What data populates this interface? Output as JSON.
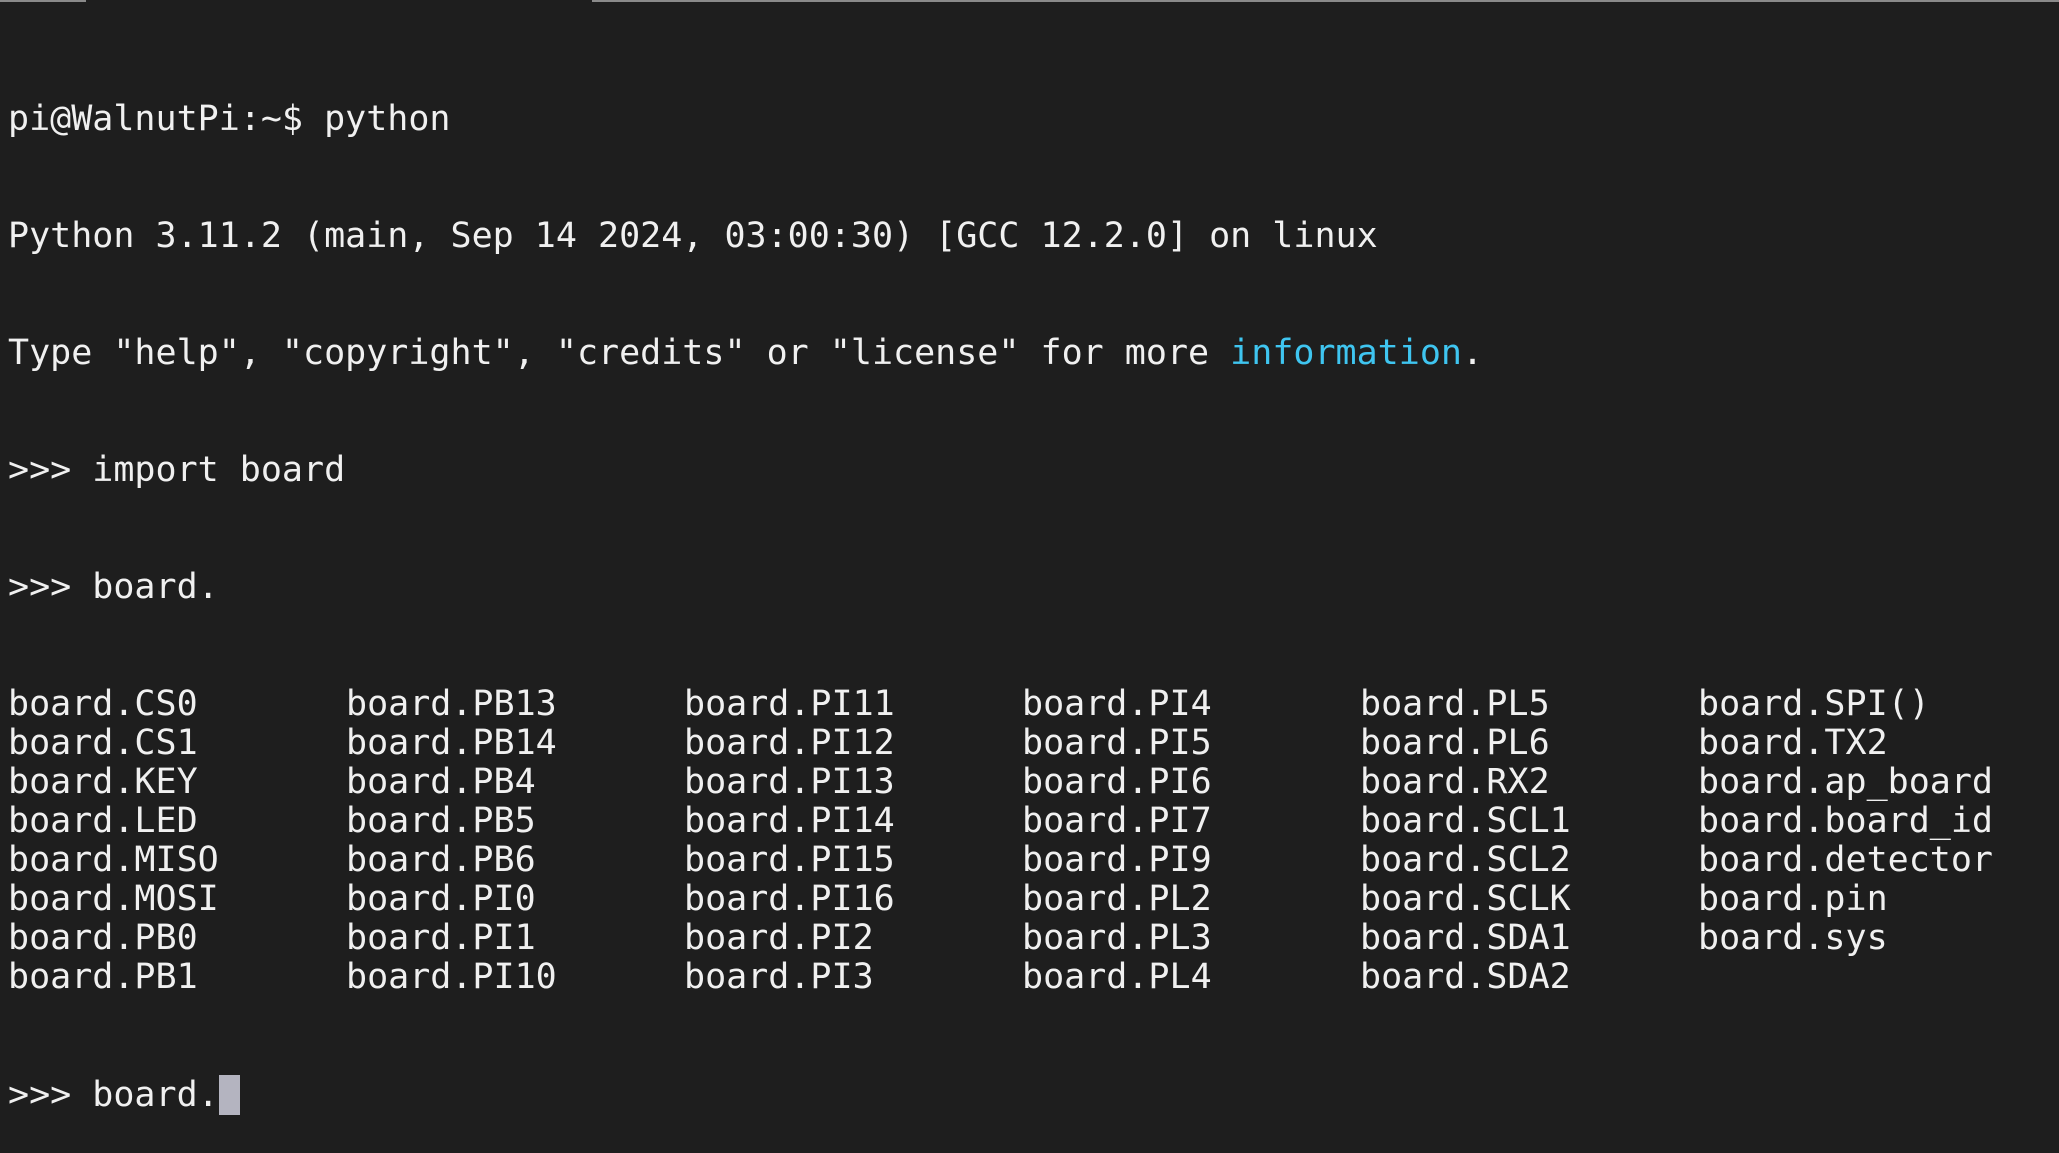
{
  "terminal": {
    "prompt_line": "pi@WalnutPi:~$ python",
    "banner_line": "Python 3.11.2 (main, Sep 14 2024, 03:00:30) [GCC 12.2.0] on linux",
    "hint_prefix": "Type \"help\", \"copyright\", \"credits\" or \"license\" for more ",
    "hint_link": "information",
    "hint_suffix": ".",
    "import_line": ">>> import board",
    "completion_input": ">>> board.",
    "completions": [
      [
        "board.CS0",
        "board.PB13",
        "board.PI11",
        "board.PI4",
        "board.PL5",
        "board.SPI()"
      ],
      [
        "board.CS1",
        "board.PB14",
        "board.PI12",
        "board.PI5",
        "board.PL6",
        "board.TX2"
      ],
      [
        "board.KEY",
        "board.PB4",
        "board.PI13",
        "board.PI6",
        "board.RX2",
        "board.ap_board"
      ],
      [
        "board.LED",
        "board.PB5",
        "board.PI14",
        "board.PI7",
        "board.SCL1",
        "board.board_id"
      ],
      [
        "board.MISO",
        "board.PB6",
        "board.PI15",
        "board.PI9",
        "board.SCL2",
        "board.detector"
      ],
      [
        "board.MOSI",
        "board.PI0",
        "board.PI16",
        "board.PL2",
        "board.SCLK",
        "board.pin"
      ],
      [
        "board.PB0",
        "board.PI1",
        "board.PI2",
        "board.PL3",
        "board.SDA1",
        "board.sys"
      ],
      [
        "board.PB1",
        "board.PI10",
        "board.PI3",
        "board.PL4",
        "board.SDA2",
        ""
      ]
    ],
    "current_input": ">>> board.",
    "colors": {
      "background": "#1e1e1e",
      "text": "#f0f0f0",
      "link": "#3fc5f0",
      "cursor": "#b4b4c0"
    }
  }
}
